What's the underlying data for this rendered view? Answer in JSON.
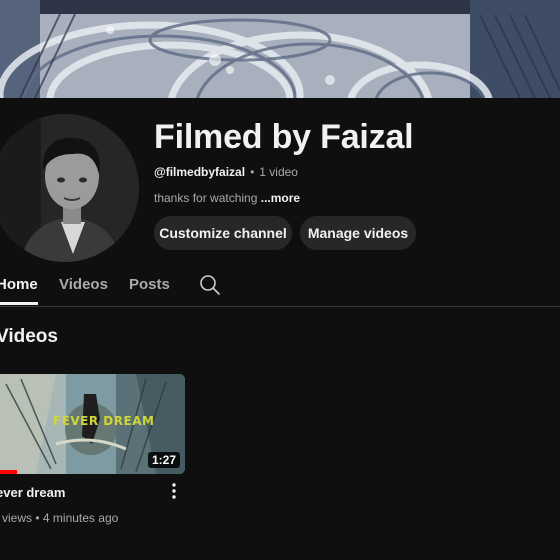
{
  "channel": {
    "name": "Filmed by Faizal",
    "handle": "@filmedbyfaizal",
    "separator": "•",
    "video_count": "1 video",
    "description": "thanks for watching",
    "more_label": "...more"
  },
  "buttons": {
    "customize": "Customize channel",
    "manage": "Manage videos"
  },
  "tabs": [
    {
      "label": "Home",
      "active": true
    },
    {
      "label": "Videos",
      "active": false
    },
    {
      "label": "Posts",
      "active": false
    }
  ],
  "icons": {
    "search": "search-icon",
    "more": "more-vert-icon"
  },
  "section": {
    "heading": "Videos"
  },
  "video": {
    "title": "ever dream",
    "overlay_text": "FEVER DREAM",
    "duration": "1:27",
    "views": "views",
    "separator": "•",
    "age": "4 minutes ago",
    "watched_fraction": 0.11
  },
  "colors": {
    "background": "#0f0f0f",
    "button_bg": "#272727",
    "progress": "#ff0000",
    "secondary_text": "#aaaaaa"
  }
}
